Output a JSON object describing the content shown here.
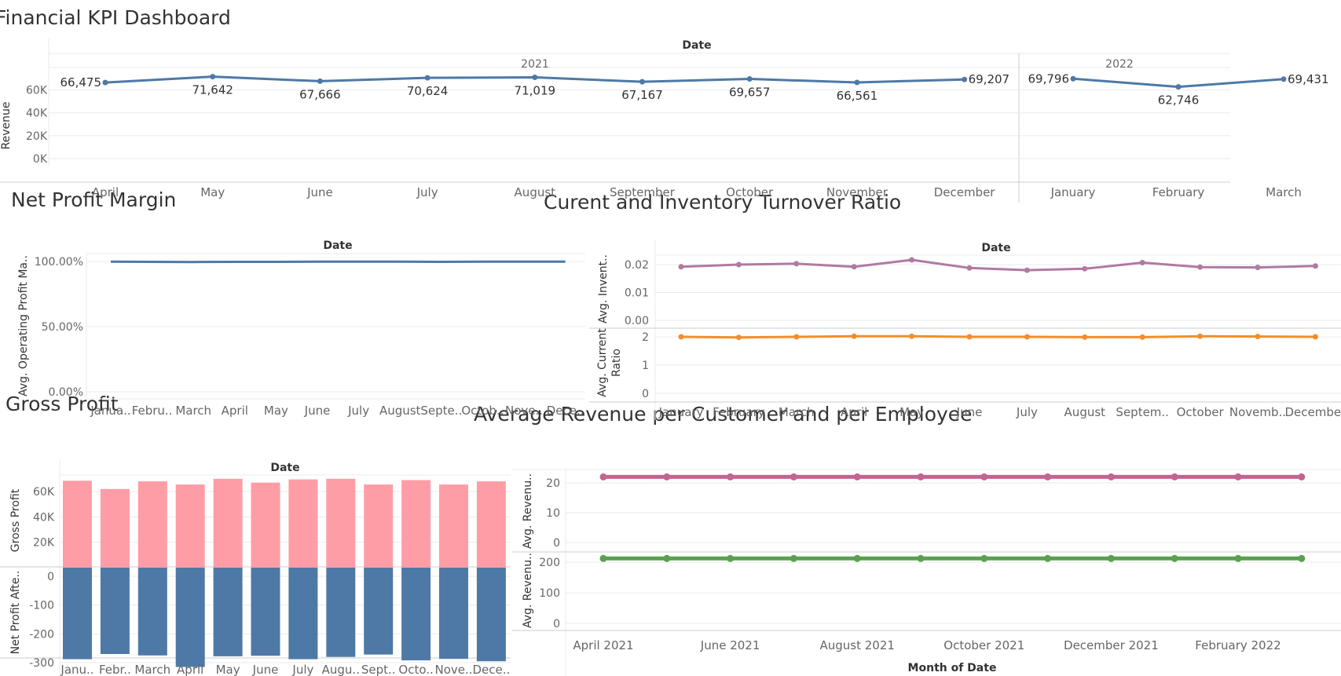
{
  "dashboard_title": "Financial KPI Dashboard",
  "panels": {
    "revenue": {
      "header": "Date"
    },
    "npm": {
      "title": "Net Profit Margin",
      "header": "Date"
    },
    "turnover": {
      "title": "Curent and Inventory Turnover Ratio",
      "header": "Date"
    },
    "gross": {
      "title": "Gross Profit",
      "header": "Date"
    },
    "arpc": {
      "title": "Average Revenue per Customer and per Employee",
      "xlabel": "Month of Date"
    }
  },
  "colors": {
    "blue": "#4e79a7",
    "purple": "#b07aa1",
    "orange": "#f28e2b",
    "pink": "#ff9da7",
    "magenta": "#c4648f",
    "green": "#59a14f",
    "grid": "#ebebeb",
    "axis": "#cccccc",
    "text": "#333333",
    "tick": "#666666"
  },
  "chart_data": [
    {
      "id": "revenue",
      "type": "line",
      "title": "Financial KPI Dashboard",
      "header": "Date",
      "ylabel": "Revenue",
      "ylim": [
        0,
        78000
      ],
      "yticks": [
        "0K",
        "20K",
        "40K",
        "60K"
      ],
      "years": [
        {
          "label": "2021",
          "months": [
            "April",
            "May",
            "June",
            "July",
            "August",
            "September",
            "October",
            "November",
            "December"
          ],
          "values": [
            66475,
            71642,
            67666,
            70624,
            71019,
            67167,
            69657,
            66561,
            69207
          ],
          "labels": [
            "66,475",
            "71,642",
            "67,666",
            "70,624",
            "71,019",
            "67,167",
            "69,657",
            "66,561",
            "69,207"
          ]
        },
        {
          "label": "2022",
          "months": [
            "January",
            "February",
            "March"
          ],
          "values": [
            69796,
            62746,
            69431
          ],
          "labels": [
            "69,796",
            "62,746",
            "69,431"
          ]
        }
      ]
    },
    {
      "id": "npm",
      "type": "line",
      "title": "Net Profit Margin",
      "header": "Date",
      "ylabel": "Avg. Operating Profit Ma..",
      "ylim": [
        0,
        1.03
      ],
      "yticks": [
        "0.00%",
        "50.00%",
        "100.00%"
      ],
      "categories": [
        "Janua..",
        "Febru..",
        "March",
        "April",
        "May",
        "June",
        "July",
        "August",
        "Septe..",
        "Octob..",
        "Nove..",
        "Dece.."
      ],
      "values": [
        0.998,
        0.997,
        0.996,
        0.997,
        0.997,
        0.998,
        0.999,
        0.999,
        0.997,
        0.998,
        0.998,
        0.998
      ]
    },
    {
      "id": "turnover",
      "type": "line",
      "title": "Curent and Inventory Turnover Ratio",
      "header": "Date",
      "categories": [
        "January",
        "February",
        "March",
        "April",
        "May",
        "June",
        "July",
        "August",
        "Septem..",
        "October",
        "Novemb..",
        "December"
      ],
      "series": [
        {
          "name": "Avg. Invent..",
          "ylim": [
            0,
            0.025
          ],
          "yticks": [
            "0.00",
            "0.01",
            "0.02"
          ],
          "values": [
            0.0192,
            0.02,
            0.0203,
            0.0192,
            0.0217,
            0.0188,
            0.018,
            0.0185,
            0.0207,
            0.0191,
            0.019,
            0.0195
          ]
        },
        {
          "name": "Avg. Current Ratio",
          "ylim": [
            0,
            2.3
          ],
          "yticks": [
            "0",
            "1",
            "2"
          ],
          "values": [
            2.0,
            1.98,
            2.0,
            2.02,
            2.02,
            2.0,
            2.0,
            1.99,
            1.99,
            2.02,
            2.01,
            2.0
          ]
        }
      ]
    },
    {
      "id": "gross",
      "type": "bar",
      "title": "Gross Profit",
      "header": "Date",
      "categories": [
        "Janu..",
        "Febr..",
        "March",
        "April",
        "May",
        "June",
        "July",
        "Augu..",
        "Sept..",
        "Octo..",
        "Nove..",
        "Dece.."
      ],
      "series": [
        {
          "name": "Gross Profit",
          "ylim": [
            0,
            73000
          ],
          "yticks": [
            "20K",
            "40K",
            "60K"
          ],
          "values": [
            68500,
            62000,
            68000,
            65500,
            70000,
            67000,
            69500,
            70000,
            65500,
            69000,
            65500,
            68000
          ]
        },
        {
          "name": "Net Profit Afte..",
          "ylim": [
            -350,
            0
          ],
          "yticks": [
            "0",
            "-100",
            "-200",
            "-300"
          ],
          "values": [
            -318,
            -300,
            -305,
            -345,
            -308,
            -306,
            -318,
            -310,
            -302,
            -322,
            -317,
            -325
          ]
        }
      ]
    },
    {
      "id": "arpc",
      "type": "line",
      "title": "Average Revenue per Customer and per Employee",
      "xlabel": "Month of Date",
      "xticks": [
        "April 2021",
        "June 2021",
        "August 2021",
        "October 2021",
        "December 2021",
        "February 2022"
      ],
      "series": [
        {
          "name": "Avg. Revenu..",
          "ylim": [
            0,
            25
          ],
          "yticks": [
            "0",
            "10",
            "20"
          ],
          "values": [
            22,
            22,
            22,
            22,
            22,
            22,
            22,
            22,
            22,
            22,
            22,
            22
          ]
        },
        {
          "name": "Avg. Revenu..",
          "ylim": [
            0,
            230
          ],
          "yticks": [
            "0",
            "100",
            "200"
          ],
          "values": [
            212,
            212,
            212,
            212,
            212,
            212,
            212,
            212,
            212,
            212,
            212,
            212
          ]
        }
      ]
    }
  ]
}
